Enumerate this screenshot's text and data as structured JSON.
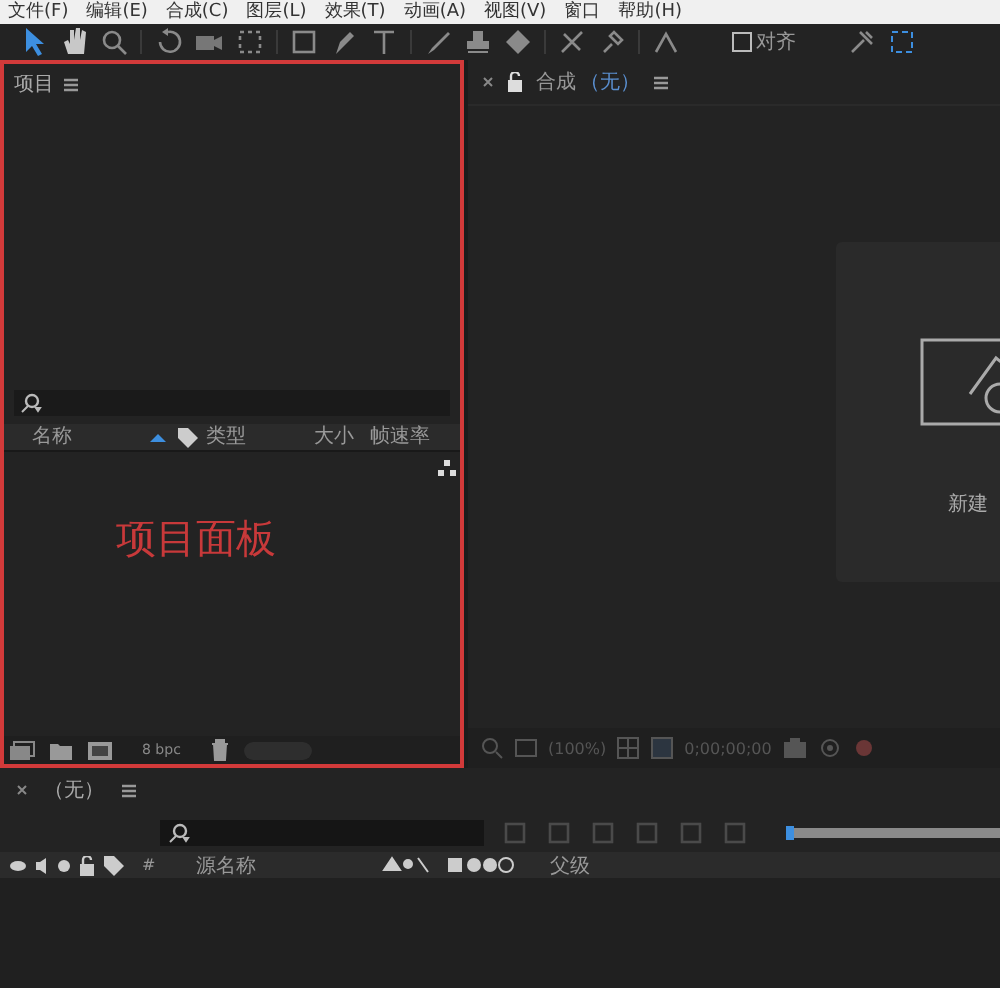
{
  "menu": [
    "文件(F)",
    "编辑(E)",
    "合成(C)",
    "图层(L)",
    "效果(T)",
    "动画(A)",
    "视图(V)",
    "窗口",
    "帮助(H)"
  ],
  "toolbar": {
    "align": {
      "label": "对齐",
      "checked": false
    }
  },
  "project_panel": {
    "title": "项目",
    "columns": [
      "名称",
      "类型",
      "大小",
      "帧速率"
    ],
    "annotation": "项目面板",
    "bit_depth": "8 bpc",
    "thumbnail_slider": {
      "level": 1
    }
  },
  "composition_panel": {
    "title": "合成",
    "comp_name": "（无）",
    "new_comp_label": "新建",
    "zoom": "(100%)",
    "timecode": "0;00;00;00"
  },
  "timeline": {
    "title": "（无）",
    "columns": [
      "#",
      "源名称",
      "父级"
    ],
    "zoom_slider": {
      "level": 0
    }
  }
}
